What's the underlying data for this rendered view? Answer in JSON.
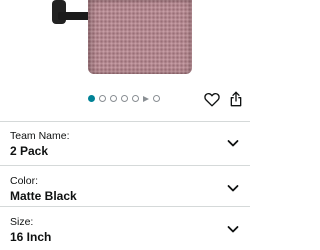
{
  "product_image": {
    "icon": "towel-bar-product-image"
  },
  "carousel": {
    "dot_count": 7,
    "active_index": 0,
    "video_index": 5,
    "accent_color": "#008296"
  },
  "actions": {
    "favorite_icon": "heart-icon",
    "share_icon": "share-icon"
  },
  "options": [
    {
      "label": "Team Name:",
      "value": "2 Pack"
    },
    {
      "label": "Color:",
      "value": "Matte Black"
    },
    {
      "label": "Size:",
      "value": "16 Inch"
    }
  ]
}
